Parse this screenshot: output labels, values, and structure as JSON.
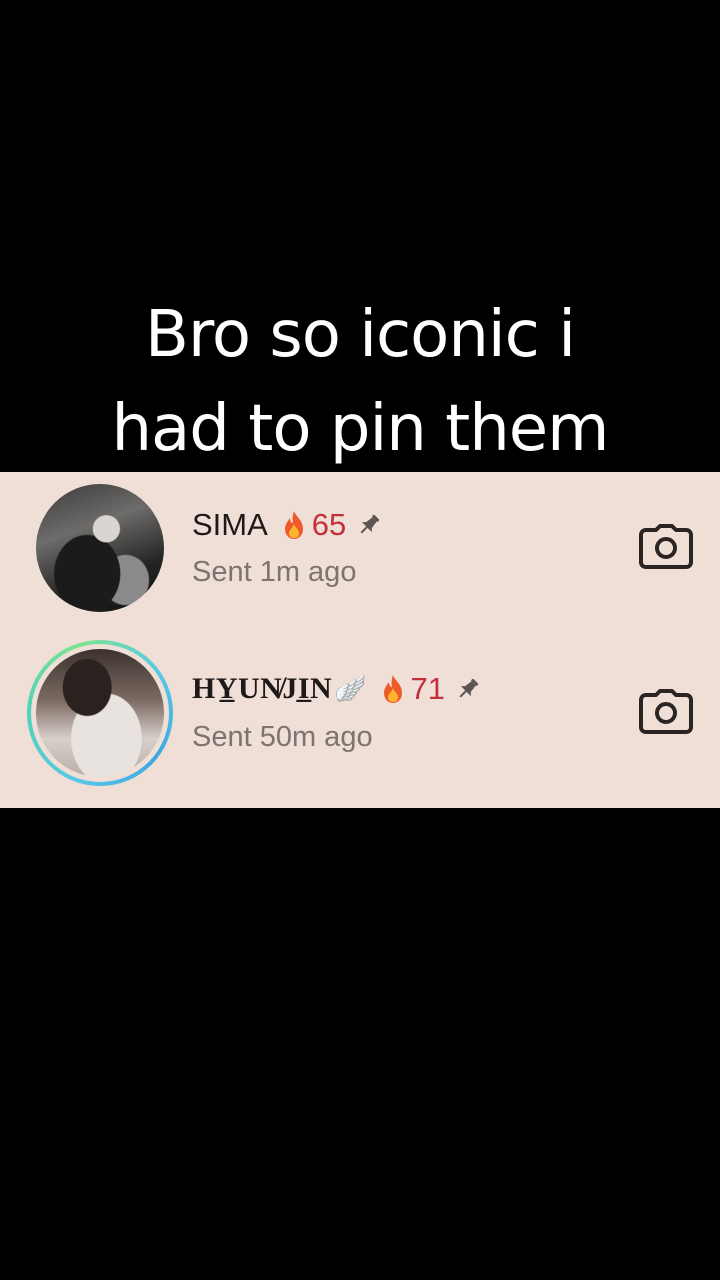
{
  "caption": {
    "line1": "Bro so iconic i",
    "line2": "had to pin them"
  },
  "chats": [
    {
      "name": "SIMA",
      "streak": "65",
      "status": "Sent 1m ago",
      "has_story_ring": false
    },
    {
      "name": "HY̲UN̸JI̲N",
      "name_suffix": "🪽",
      "streak": "71",
      "status": "Sent 50m ago",
      "has_story_ring": true
    }
  ],
  "colors": {
    "background": "#000000",
    "panel": "#f0dfd6",
    "streak": "#c4303a",
    "status": "#7c7471",
    "caption": "#ffffff"
  },
  "icons": [
    "fire-icon",
    "pin-icon",
    "camera-icon"
  ]
}
